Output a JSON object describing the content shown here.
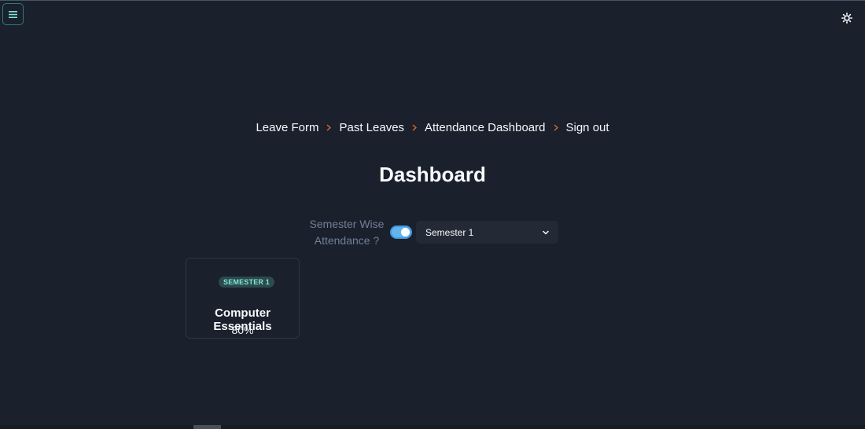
{
  "header": {
    "menu_icon": "hamburger-icon",
    "theme_icon": "sun-icon"
  },
  "nav": {
    "items": [
      {
        "label": "Leave Form"
      },
      {
        "label": "Past Leaves"
      },
      {
        "label": "Attendance Dashboard"
      },
      {
        "label": "Sign out"
      }
    ],
    "separator_icon": "chevron-right-icon",
    "separator_color": "#dd6b20"
  },
  "page": {
    "title": "Dashboard"
  },
  "filter": {
    "toggle_label_line1": "Semester Wise",
    "toggle_label_line2": "Attendance ?",
    "toggle_on": true,
    "toggle_color": "#63b3ed",
    "select_value": "Semester 1"
  },
  "courses": [
    {
      "badge": "SEMESTER 1",
      "name": "Computer Essentials",
      "attendance": "80%"
    }
  ],
  "colors": {
    "background": "#1a202c",
    "accent": "#81e6d9",
    "menu_border": "#2c7a7b"
  }
}
